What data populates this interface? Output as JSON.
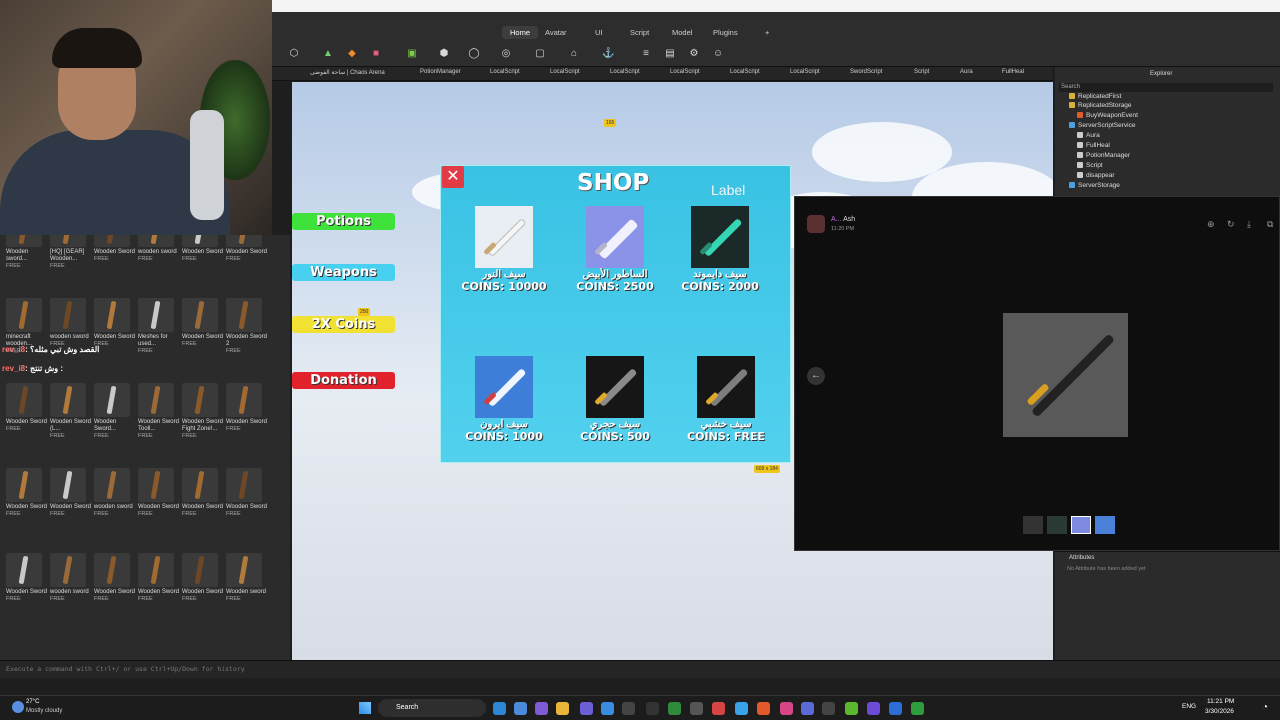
{
  "ribbon": {
    "tabs": [
      "Home",
      "Avatar",
      "UI",
      "Script",
      "Model",
      "Plugins",
      "+"
    ],
    "active_tab": "Home"
  },
  "doc_tabs": [
    "ساحة الفوضى | Chaos Arena",
    "PotionManager",
    "LocalScript",
    "LocalScript",
    "LocalScript",
    "LocalScript",
    "LocalScript",
    "LocalScript",
    "SwordScript",
    "Script",
    "Aura",
    "FullHeal"
  ],
  "toolbox": {
    "rows": [
      [
        {
          "name": "Wooden sword...",
          "free": "FREE"
        },
        {
          "name": "[HQ] [GEAR] Wooden...",
          "free": "FREE"
        },
        {
          "name": "Wooden Sword",
          "free": "FREE"
        },
        {
          "name": "wooden sword",
          "free": "FREE"
        },
        {
          "name": "Wooden Sword",
          "free": "FREE"
        },
        {
          "name": "Wooden Sword",
          "free": "FREE"
        }
      ],
      [
        {
          "name": "minecraft wooden...",
          "free": "FREE"
        },
        {
          "name": "wooden sword",
          "free": "FREE"
        },
        {
          "name": "Wooden Sword",
          "free": "FREE"
        },
        {
          "name": "Meshes for used...",
          "free": "FREE"
        },
        {
          "name": "Wooden Sword",
          "free": "FREE"
        },
        {
          "name": "Wooden Sword 2",
          "free": "FREE"
        }
      ],
      [
        {
          "name": "Wooden Sword",
          "free": "FREE"
        },
        {
          "name": "Wooden Sword (L...",
          "free": "FREE"
        },
        {
          "name": "Wooden Sword...",
          "free": "FREE"
        },
        {
          "name": "Wooden Sword Tooll...",
          "free": "FREE"
        },
        {
          "name": "Wooden Sword Fight Zone!...",
          "free": "FREE"
        },
        {
          "name": "Wooden Sword",
          "free": "FREE"
        }
      ],
      [
        {
          "name": "Wooden Sword",
          "free": "FREE"
        },
        {
          "name": "Wooden Sword",
          "free": "FREE"
        },
        {
          "name": "wooden sword",
          "free": "FREE"
        },
        {
          "name": "Wooden Sword",
          "free": "FREE"
        },
        {
          "name": "Wooden Sword",
          "free": "FREE"
        },
        {
          "name": "Wooden Sword",
          "free": "FREE"
        }
      ],
      [
        {
          "name": "Wooden Sword",
          "free": "FREE"
        },
        {
          "name": "wooden sword",
          "free": "FREE"
        },
        {
          "name": "Wooden Sword",
          "free": "FREE"
        },
        {
          "name": "Wooden Sword",
          "free": "FREE"
        },
        {
          "name": "Wooden Sword",
          "free": "FREE"
        },
        {
          "name": "Wooden sword",
          "free": "FREE"
        }
      ]
    ]
  },
  "chat": [
    {
      "user": "rev_i8",
      "text": "القصد وش تبي مثله؟"
    },
    {
      "user": "rev_i8",
      "text": "وش تنتج :"
    }
  ],
  "game_ui": {
    "side_buttons": [
      {
        "label": "Potions",
        "color": "#3ee23a"
      },
      {
        "label": "Weapons",
        "color": "#47d0f0"
      },
      {
        "label": "2X Coins",
        "color": "#f1e133"
      },
      {
        "label": "Donation",
        "color": "#e1212b"
      }
    ],
    "shop": {
      "title": "SHOP",
      "label": "Label",
      "close": "✕",
      "items": [
        {
          "name": "سيف النور",
          "price": "COINS: 10000"
        },
        {
          "name": "الساطور الأبيض",
          "price": "COINS: 2500"
        },
        {
          "name": "سيف دايموند",
          "price": "COINS: 2000"
        },
        {
          "name": "سيف ايرون",
          "price": "COINS: 1000"
        },
        {
          "name": "سيف حجري",
          "price": "COINS: 500"
        },
        {
          "name": "سيف خشبي",
          "price": "COINS: FREE"
        }
      ]
    },
    "markers": {
      "top": "165",
      "left": "250",
      "size": "609 x 184"
    }
  },
  "explorer": {
    "title": "Explorer",
    "search_placeholder": "Search",
    "items": [
      "ReplicatedFirst",
      "ReplicatedStorage",
      "BuyWeaponEvent",
      "ServerScriptService",
      "Aura",
      "FullHeal",
      "PotionManager",
      "Script",
      "disappear",
      "ServerStorage"
    ]
  },
  "viewer": {
    "user": "A...",
    "tag": "Ash",
    "time": "11:20 PM"
  },
  "attributes": {
    "title": "Attributes",
    "empty": "No Attribute has been added yet"
  },
  "command_bar": {
    "placeholder": "Execute a command with Ctrl+/ or use Ctrl+Up/Down for history"
  },
  "taskbar": {
    "weather_temp": "27°C",
    "weather_desc": "Mostly cloudy",
    "search": "Search",
    "lang": "ENG",
    "time": "11:21 PM",
    "date": "3/30/2026"
  }
}
